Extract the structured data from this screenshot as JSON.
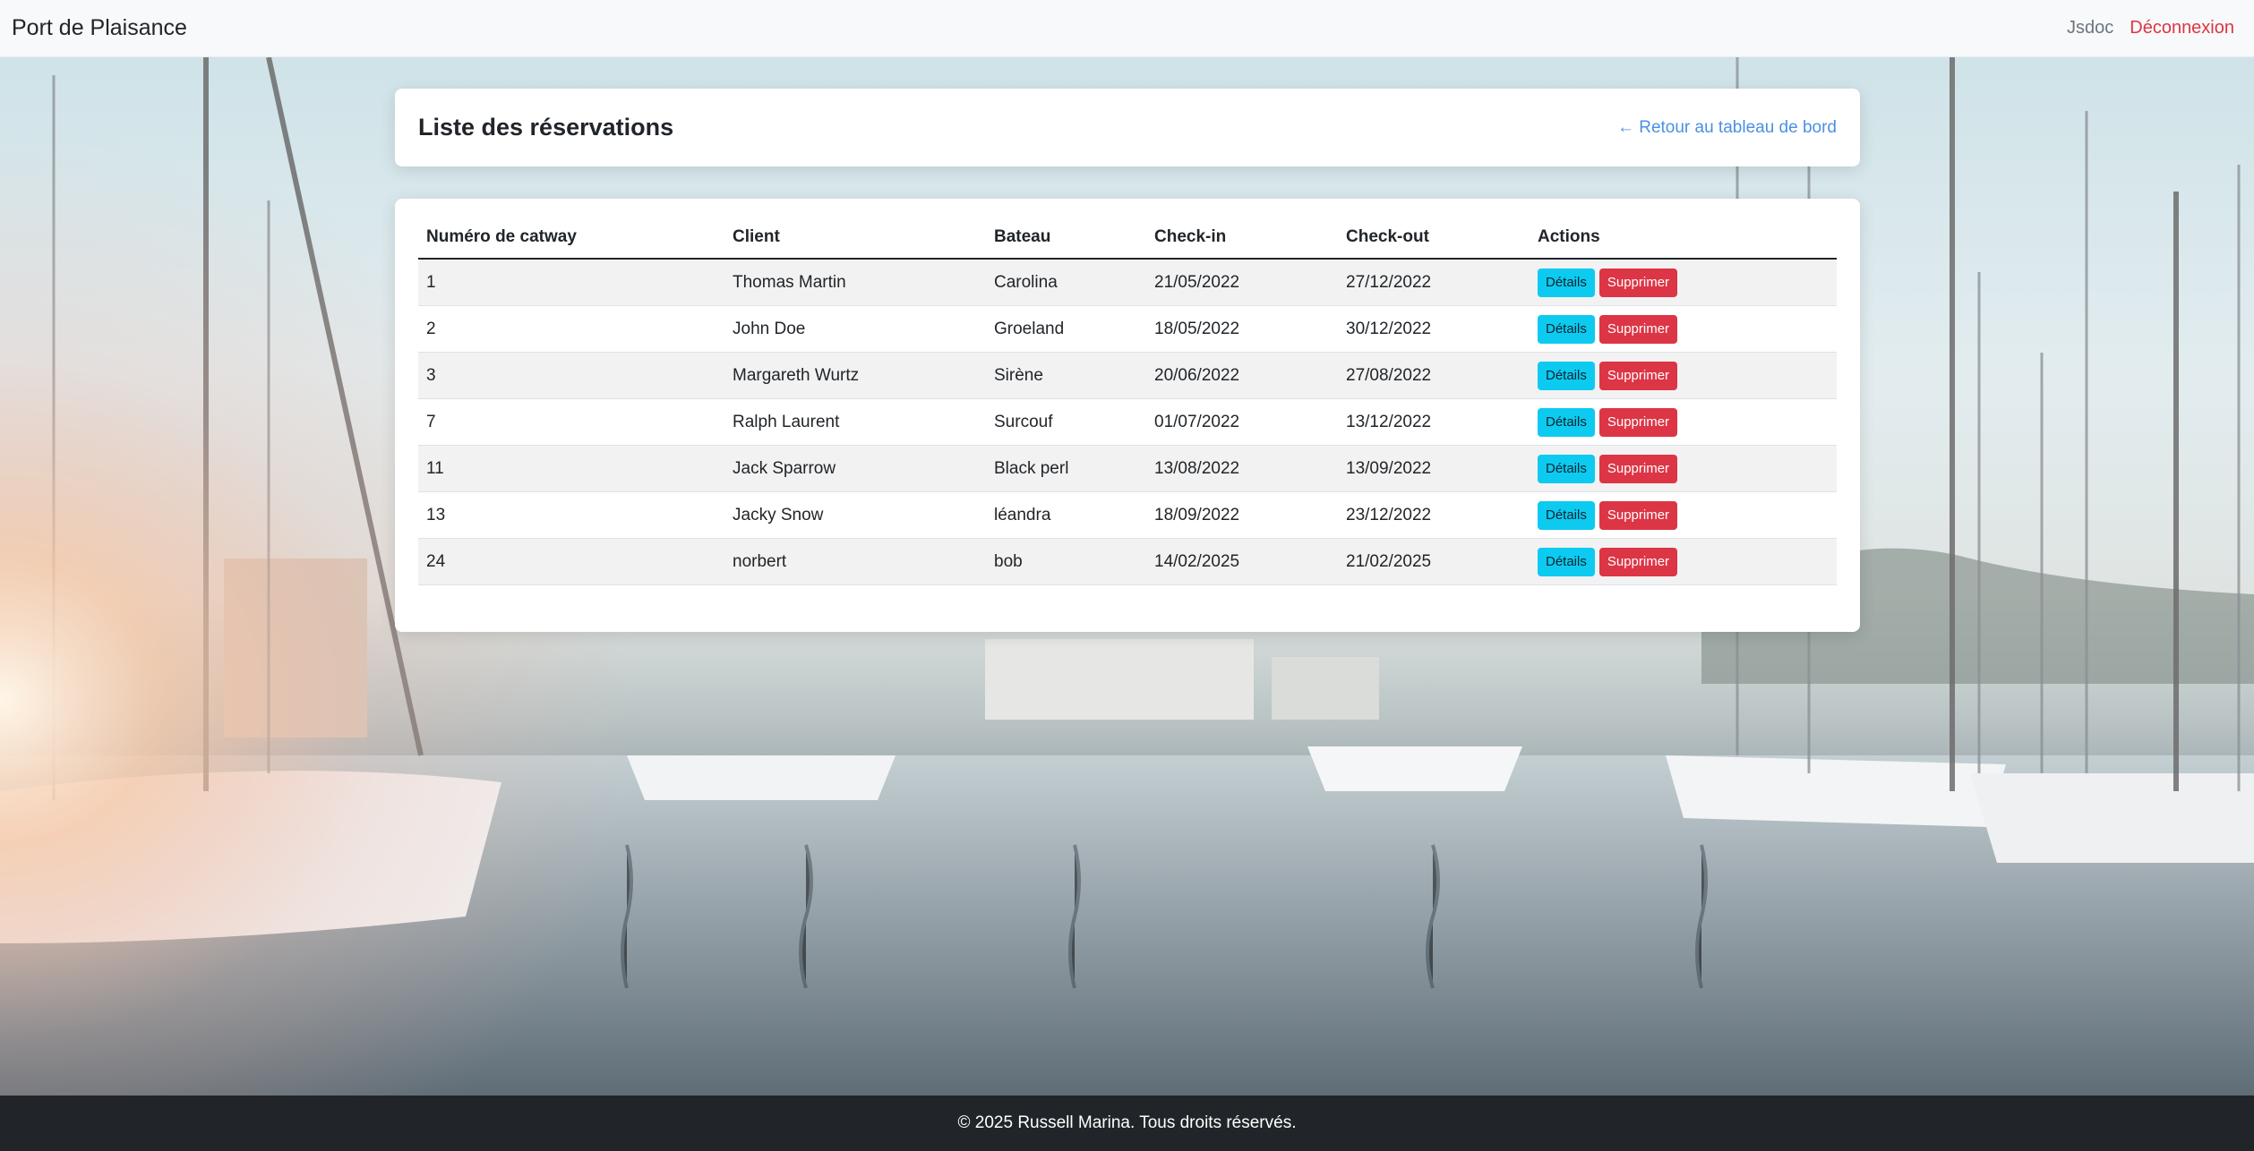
{
  "navbar": {
    "brand": "Port de Plaisance",
    "links": [
      {
        "label": "Jsdoc"
      },
      {
        "label": "Déconnexion"
      }
    ]
  },
  "header": {
    "title": "Liste des réservations",
    "back_link": "← Retour au tableau de bord"
  },
  "table": {
    "columns": [
      "Numéro de catway",
      "Client",
      "Bateau",
      "Check-in",
      "Check-out",
      "Actions"
    ],
    "rows": [
      {
        "catway": "1",
        "client": "Thomas Martin",
        "boat": "Carolina",
        "checkin": "21/05/2022",
        "checkout": "27/12/2022"
      },
      {
        "catway": "2",
        "client": "John Doe",
        "boat": "Groeland",
        "checkin": "18/05/2022",
        "checkout": "30/12/2022"
      },
      {
        "catway": "3",
        "client": "Margareth Wurtz",
        "boat": "Sirène",
        "checkin": "20/06/2022",
        "checkout": "27/08/2022"
      },
      {
        "catway": "7",
        "client": "Ralph Laurent",
        "boat": "Surcouf",
        "checkin": "01/07/2022",
        "checkout": "13/12/2022"
      },
      {
        "catway": "11",
        "client": "Jack Sparrow",
        "boat": "Black perl",
        "checkin": "13/08/2022",
        "checkout": "13/09/2022"
      },
      {
        "catway": "13",
        "client": "Jacky Snow",
        "boat": "léandra",
        "checkin": "18/09/2022",
        "checkout": "23/12/2022"
      },
      {
        "catway": "24",
        "client": "norbert",
        "boat": "bob",
        "checkin": "14/02/2025",
        "checkout": "21/02/2025"
      }
    ],
    "actions": {
      "details_label": "Détails",
      "delete_label": "Supprimer"
    }
  },
  "footer": {
    "text": "© 2025 Russell Marina. Tous droits réservés."
  },
  "colors": {
    "details_button": "#0dcaf0",
    "delete_button": "#dc3545",
    "logout_link": "#dc3545",
    "back_link": "#4a90e2",
    "footer_bg": "#212529"
  }
}
